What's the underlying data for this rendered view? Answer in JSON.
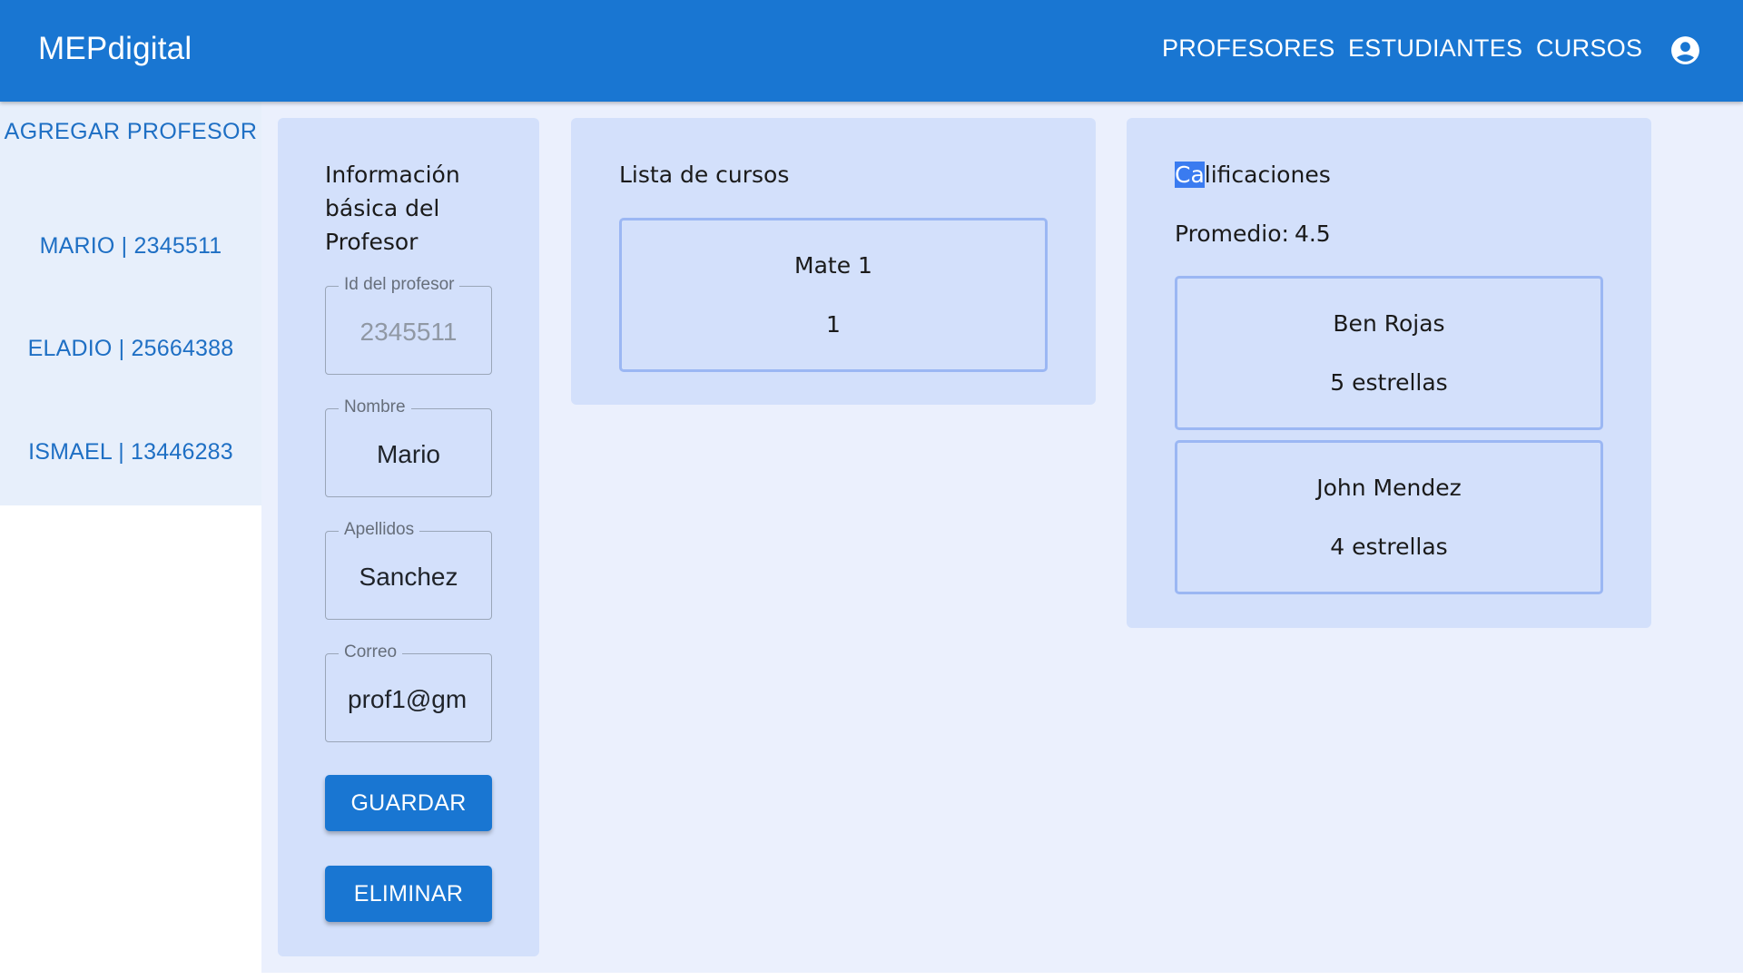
{
  "header": {
    "brand": "MEPdigital",
    "nav": [
      "PROFESORES",
      "ESTUDIANTES",
      "CURSOS"
    ],
    "account_icon": "account-circle-icon"
  },
  "sidebar": {
    "add_label": "AGREGAR PROFESOR",
    "items": [
      "MARIO | 2345511",
      "ELADIO | 25664388",
      "ISMAEL | 13446283"
    ]
  },
  "info_card": {
    "title": "Información básica del Profesor",
    "fields": {
      "id": {
        "label": "Id del profesor",
        "value": "2345511"
      },
      "nombre": {
        "label": "Nombre",
        "value": "Mario"
      },
      "apellidos": {
        "label": "Apellidos",
        "value": "Sanchez"
      },
      "correo": {
        "label": "Correo",
        "value": "prof1@gm"
      }
    },
    "save_label": "GUARDAR",
    "delete_label": "ELIMINAR"
  },
  "courses_card": {
    "title": "Lista de cursos",
    "courses": [
      {
        "name": "Mate 1",
        "number": "1"
      }
    ]
  },
  "grades_card": {
    "title_selected": "Ca",
    "title_rest": "lificaciones",
    "average_label": "Promedio:",
    "average_value": "4.5",
    "ratings": [
      {
        "student": "Ben Rojas",
        "stars": "5 estrellas"
      },
      {
        "student": "John Mendez",
        "stars": "4 estrellas"
      }
    ]
  },
  "colors": {
    "primary": "#1976d2",
    "card_bg": "#d3e0fb",
    "page_bg": "#ebf0fd",
    "sidebar_bg": "#e7effb",
    "link": "#1e6fc4",
    "selection": "#3a7bf0"
  }
}
